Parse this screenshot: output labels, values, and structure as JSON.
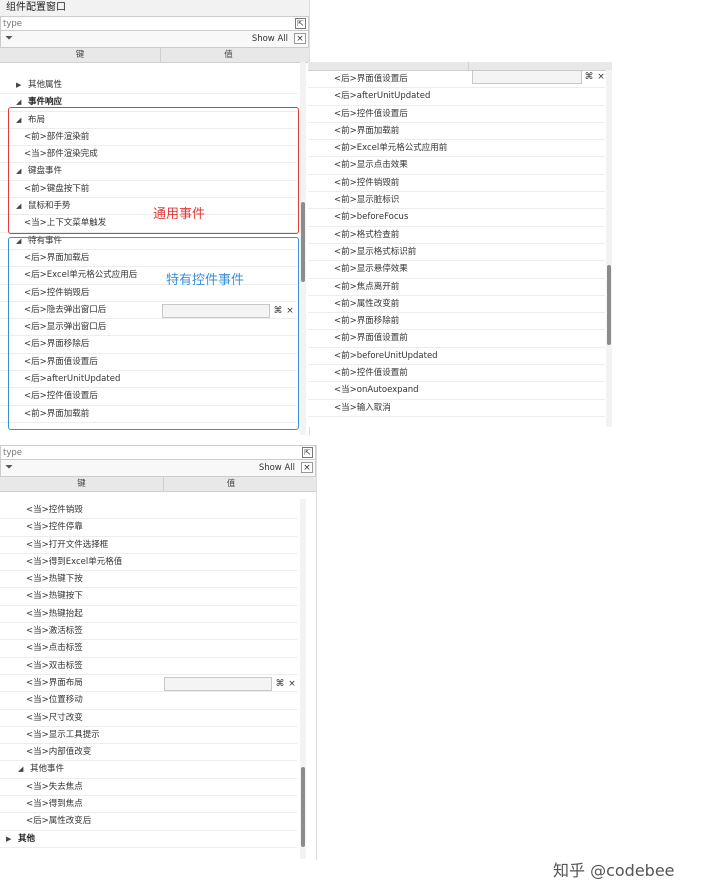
{
  "window_title": "组件配置窗口",
  "search_placeholder": "type",
  "filter_label": "Show All",
  "col_key": "键",
  "col_value": "值",
  "panel1": {
    "rows": [
      {
        "label": "其他属性",
        "type": "group-collapsed"
      },
      {
        "label": "事件响应",
        "type": "section-expanded"
      },
      {
        "label": "布局",
        "type": "group-expanded"
      },
      {
        "label": "<前>部件渲染前",
        "type": "item"
      },
      {
        "label": "<当>部件渲染完成",
        "type": "item"
      },
      {
        "label": "键盘事件",
        "type": "group-expanded"
      },
      {
        "label": "<前>键盘按下前",
        "type": "item"
      },
      {
        "label": "鼠标和手势",
        "type": "group-expanded"
      },
      {
        "label": "<当>上下文菜单触发",
        "type": "item"
      },
      {
        "label": "特有事件",
        "type": "group-expanded"
      },
      {
        "label": "<后>界面加载后",
        "type": "item"
      },
      {
        "label": "<后>Excel单元格公式应用后",
        "type": "item"
      },
      {
        "label": "<后>控件销毁后",
        "type": "item"
      },
      {
        "label": "<后>隐去弹出窗口后",
        "type": "item-selected"
      },
      {
        "label": "<后>显示弹出窗口后",
        "type": "item"
      },
      {
        "label": "<后>界面移除后",
        "type": "item"
      },
      {
        "label": "<后>界面值设置后",
        "type": "item"
      },
      {
        "label": "<后>afterUnitUpdated",
        "type": "item"
      },
      {
        "label": "<后>控件值设置后",
        "type": "item"
      },
      {
        "label": "<前>界面加载前",
        "type": "item"
      }
    ]
  },
  "panel2": {
    "rows": [
      "<后>界面值设置后",
      "<后>afterUnitUpdated",
      "<后>控件值设置后",
      "<前>界面加载前",
      "<前>Excel单元格公式应用前",
      "<前>显示点击效果",
      "<前>控件销毁前",
      "<前>显示脏标识",
      "<前>beforeFocus",
      "<前>格式检查前",
      "<前>显示格式标识前",
      "<前>显示悬停效果",
      "<前>焦点离开前",
      "<前>属性改变前",
      "<前>界面移除前",
      "<前>界面值设置前",
      "<前>beforeUnitUpdated",
      "<前>控件值设置前",
      "<当>onAutoexpand",
      "<当>输入取消"
    ]
  },
  "panel3": {
    "rows": [
      {
        "label": "<当>控件销毁",
        "type": "item"
      },
      {
        "label": "<当>控件停靠",
        "type": "item"
      },
      {
        "label": "<当>打开文件选择框",
        "type": "item"
      },
      {
        "label": "<当>得到Excel单元格值",
        "type": "item"
      },
      {
        "label": "<当>热键下按",
        "type": "item"
      },
      {
        "label": "<当>热键按下",
        "type": "item"
      },
      {
        "label": "<当>热键抬起",
        "type": "item"
      },
      {
        "label": "<当>激活标签",
        "type": "item"
      },
      {
        "label": "<当>点击标签",
        "type": "item"
      },
      {
        "label": "<当>双击标签",
        "type": "item"
      },
      {
        "label": "<当>界面布局",
        "type": "item-selected"
      },
      {
        "label": "<当>位置移动",
        "type": "item"
      },
      {
        "label": "<当>尺寸改变",
        "type": "item"
      },
      {
        "label": "<当>显示工具提示",
        "type": "item"
      },
      {
        "label": "<当>内部值改变",
        "type": "item"
      },
      {
        "label": "其他事件",
        "type": "group-expanded"
      },
      {
        "label": "<当>失去焦点",
        "type": "item"
      },
      {
        "label": "<当>得到焦点",
        "type": "item"
      },
      {
        "label": "<后>属性改变后",
        "type": "item"
      },
      {
        "label": "其他",
        "type": "section-collapsed"
      }
    ]
  },
  "annotations": {
    "general_label": "通用事件",
    "special_label": "特有控件事件"
  },
  "value_buttons": {
    "cmd": "⌘",
    "clear": "×"
  },
  "watermark": "知乎 @codebee",
  "colors": {
    "red": "#e03a3a",
    "blue": "#3a8fd9"
  }
}
